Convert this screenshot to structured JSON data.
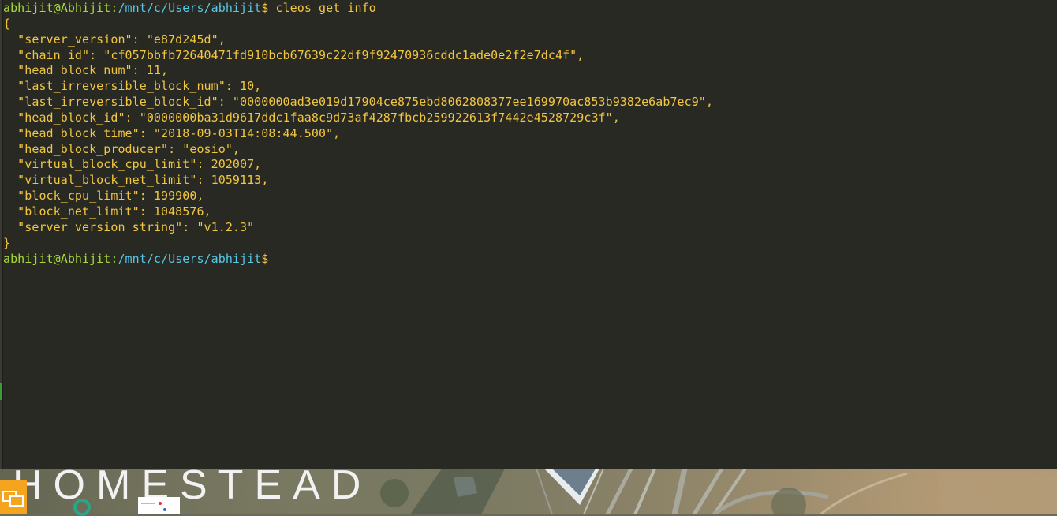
{
  "terminal": {
    "prompt": {
      "user_host": "abhijit@Abhijit",
      "separator": ":",
      "path": "/mnt/c/Users/abhijit",
      "symbol": "$"
    },
    "command": " cleos get info",
    "output_lines": [
      "{",
      "  \"server_version\": \"e87d245d\",",
      "  \"chain_id\": \"cf057bbfb72640471fd910bcb67639c22df9f92470936cddc1ade0e2f2e7dc4f\",",
      "  \"head_block_num\": 11,",
      "  \"last_irreversible_block_num\": 10,",
      "  \"last_irreversible_block_id\": \"0000000ad3e019d17904ce875ebd8062808377ee169970ac853b9382e6ab7ec9\",",
      "  \"head_block_id\": \"0000000ba31d9617ddc1faa8c9d73af4287fbcb259922613f7442e4528729c3f\",",
      "  \"head_block_time\": \"2018-09-03T14:08:44.500\",",
      "  \"head_block_producer\": \"eosio\",",
      "  \"virtual_block_cpu_limit\": 202007,",
      "  \"virtual_block_net_limit\": 1059113,",
      "  \"block_cpu_limit\": 199900,",
      "  \"block_net_limit\": 1048576,",
      "  \"server_version_string\": \"v1.2.3\"",
      "}"
    ]
  },
  "desktop": {
    "wallpaper_title": "HOMESTEAD",
    "icon_names": [
      "monitor-icon",
      "circle-icon"
    ]
  },
  "colors": {
    "terminal_bg": "#282923",
    "user_host": "#a9da3a",
    "path": "#57c8e6",
    "text": "#f2c641"
  }
}
